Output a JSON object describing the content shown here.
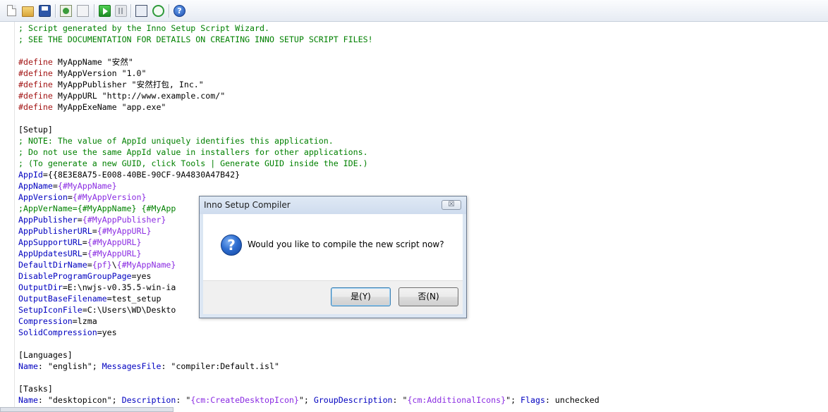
{
  "toolbar": {
    "buttons": [
      "new-icon",
      "open-icon",
      "save-icon",
      "compile-icon",
      "stop-compile-icon",
      "run-icon",
      "pause-icon",
      "target-icon",
      "refresh-icon",
      "help-icon"
    ],
    "help_glyph": "?"
  },
  "editor": {
    "lines": [
      [
        {
          "t": "; Script generated by the Inno Setup Script Wizard.",
          "c": "comment"
        }
      ],
      [
        {
          "t": "; SEE THE DOCUMENTATION FOR DETAILS ON CREATING INNO SETUP SCRIPT FILES!",
          "c": "comment"
        }
      ],
      [],
      [
        {
          "t": "#define",
          "c": "define"
        },
        {
          "t": " MyAppName \"安然\"",
          "c": "string"
        }
      ],
      [
        {
          "t": "#define",
          "c": "define"
        },
        {
          "t": " MyAppVersion \"1.0\"",
          "c": "string"
        }
      ],
      [
        {
          "t": "#define",
          "c": "define"
        },
        {
          "t": " MyAppPublisher \"安然打包, Inc.\"",
          "c": "string"
        }
      ],
      [
        {
          "t": "#define",
          "c": "define"
        },
        {
          "t": " MyAppURL \"http://www.example.com/\"",
          "c": "string"
        }
      ],
      [
        {
          "t": "#define",
          "c": "define"
        },
        {
          "t": " MyAppExeName \"app.exe\"",
          "c": "string"
        }
      ],
      [],
      [
        {
          "t": "[Setup]",
          "c": "section"
        }
      ],
      [
        {
          "t": "; NOTE: The value of AppId uniquely identifies this application.",
          "c": "comment"
        }
      ],
      [
        {
          "t": "; Do not use the same AppId value in installers for other applications.",
          "c": "comment"
        }
      ],
      [
        {
          "t": "; (To generate a new GUID, click Tools | Generate GUID inside the IDE.)",
          "c": "comment"
        }
      ],
      [
        {
          "t": "AppId",
          "c": "key"
        },
        {
          "t": "={{8E3E8A75-E008-40BE-90CF-9A4830A47B42}",
          "c": "string"
        }
      ],
      [
        {
          "t": "AppName",
          "c": "key"
        },
        {
          "t": "=",
          "c": "string"
        },
        {
          "t": "{#MyAppName}",
          "c": "const"
        }
      ],
      [
        {
          "t": "AppVersion",
          "c": "key"
        },
        {
          "t": "=",
          "c": "string"
        },
        {
          "t": "{#MyAppVersion}",
          "c": "const"
        }
      ],
      [
        {
          "t": ";AppVerName={#MyAppName} {#MyApp",
          "c": "comment"
        }
      ],
      [
        {
          "t": "AppPublisher",
          "c": "key"
        },
        {
          "t": "=",
          "c": "string"
        },
        {
          "t": "{#MyAppPublisher}",
          "c": "const"
        }
      ],
      [
        {
          "t": "AppPublisherURL",
          "c": "key"
        },
        {
          "t": "=",
          "c": "string"
        },
        {
          "t": "{#MyAppURL}",
          "c": "const"
        }
      ],
      [
        {
          "t": "AppSupportURL",
          "c": "key"
        },
        {
          "t": "=",
          "c": "string"
        },
        {
          "t": "{#MyAppURL}",
          "c": "const"
        }
      ],
      [
        {
          "t": "AppUpdatesURL",
          "c": "key"
        },
        {
          "t": "=",
          "c": "string"
        },
        {
          "t": "{#MyAppURL}",
          "c": "const"
        }
      ],
      [
        {
          "t": "DefaultDirName",
          "c": "key"
        },
        {
          "t": "=",
          "c": "string"
        },
        {
          "t": "{pf}",
          "c": "const"
        },
        {
          "t": "\\",
          "c": "string"
        },
        {
          "t": "{#MyAppName}",
          "c": "const"
        }
      ],
      [
        {
          "t": "DisableProgramGroupPage",
          "c": "key"
        },
        {
          "t": "=yes",
          "c": "string"
        }
      ],
      [
        {
          "t": "OutputDir",
          "c": "key"
        },
        {
          "t": "=E:\\nwjs-v0.35.5-win-ia",
          "c": "string"
        }
      ],
      [
        {
          "t": "OutputBaseFilename",
          "c": "key"
        },
        {
          "t": "=test_setup",
          "c": "string"
        }
      ],
      [
        {
          "t": "SetupIconFile",
          "c": "key"
        },
        {
          "t": "=C:\\Users\\WD\\Deskto",
          "c": "string"
        }
      ],
      [
        {
          "t": "Compression",
          "c": "key"
        },
        {
          "t": "=lzma",
          "c": "string"
        }
      ],
      [
        {
          "t": "SolidCompression",
          "c": "key"
        },
        {
          "t": "=yes",
          "c": "string"
        }
      ],
      [],
      [
        {
          "t": "[Languages]",
          "c": "section"
        }
      ],
      [
        {
          "t": "Name",
          "c": "key"
        },
        {
          "t": ": \"english\"; ",
          "c": "string"
        },
        {
          "t": "MessagesFile",
          "c": "key"
        },
        {
          "t": ": \"compiler:Default.isl\"",
          "c": "string"
        }
      ],
      [],
      [
        {
          "t": "[Tasks]",
          "c": "section"
        }
      ],
      [
        {
          "t": "Name",
          "c": "key"
        },
        {
          "t": ": \"desktopicon\"; ",
          "c": "string"
        },
        {
          "t": "Description",
          "c": "key"
        },
        {
          "t": ": \"",
          "c": "string"
        },
        {
          "t": "{cm:CreateDesktopIcon}",
          "c": "const"
        },
        {
          "t": "\"; ",
          "c": "string"
        },
        {
          "t": "GroupDescription",
          "c": "key"
        },
        {
          "t": ": \"",
          "c": "string"
        },
        {
          "t": "{cm:AdditionalIcons}",
          "c": "const"
        },
        {
          "t": "\"; ",
          "c": "string"
        },
        {
          "t": "Flags",
          "c": "key"
        },
        {
          "t": ": unchecked",
          "c": "string"
        }
      ]
    ]
  },
  "dialog": {
    "title": "Inno Setup Compiler",
    "close_glyph": "☒",
    "icon_glyph": "?",
    "message": "Would you like to compile the new script now?",
    "yes_label": "是(Y)",
    "no_label": "否(N)"
  },
  "colors": {
    "comment": "#008000",
    "define": "#a31515",
    "key": "#0000c0",
    "const": "#8a2be2",
    "dialog_frame": "#dbe6f3"
  }
}
